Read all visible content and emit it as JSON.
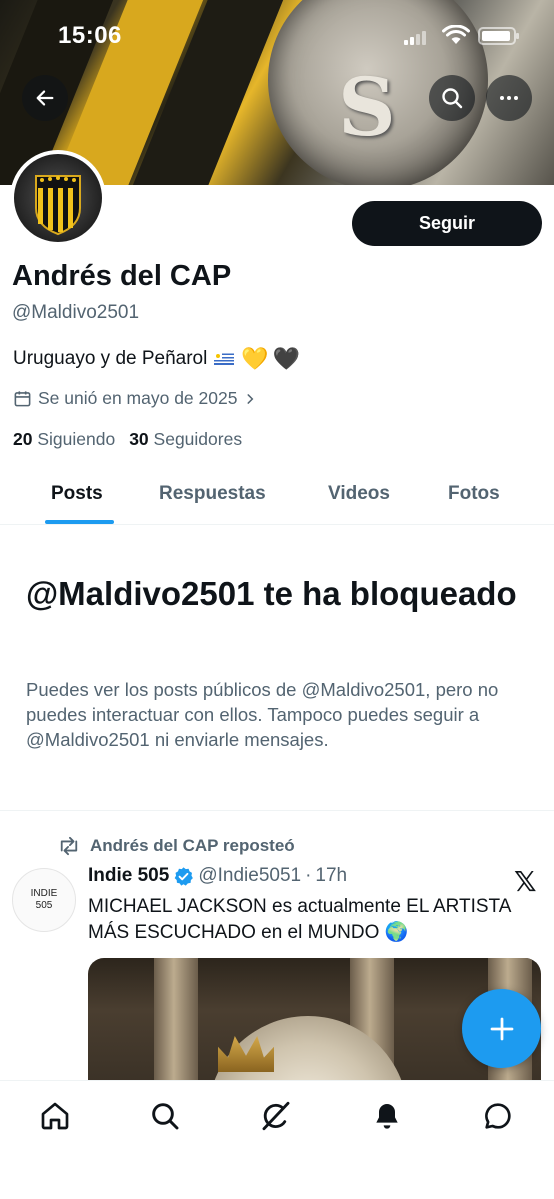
{
  "status_bar": {
    "time": "15:06"
  },
  "header": {
    "back_icon": "arrow-left-icon",
    "search_icon": "search-icon",
    "more_icon": "more-icon"
  },
  "profile": {
    "follow_label": "Seguir",
    "display_name": "Andrés del CAP",
    "handle": "@Maldivo2501",
    "bio_text": "Uruguayo y de Peñarol",
    "bio_emojis": [
      "flag-uruguay",
      "💛",
      "🖤"
    ],
    "joined": "Se unió en mayo de 2025",
    "following_count": "20",
    "following_label": "Siguiendo",
    "followers_count": "30",
    "followers_label": "Seguidores"
  },
  "tabs": [
    {
      "label": "Posts",
      "active": true
    },
    {
      "label": "Respuestas",
      "active": false
    },
    {
      "label": "Videos",
      "active": false
    },
    {
      "label": "Fotos",
      "active": false
    }
  ],
  "blocked": {
    "title": "@Maldivo2501 te ha bloqueado",
    "message": "Puedes ver los posts públicos de @Maldivo2501, pero no puedes interactuar con ellos. Tampoco puedes seguir a @Maldivo2501 ni enviarle mensajes."
  },
  "post": {
    "repost_label": "Andrés del CAP reposteó",
    "avatar_text_1": "INDIE",
    "avatar_text_2": "505",
    "author_name": "Indie 505",
    "author_handle": "@Indie5051",
    "separator": "·",
    "time": "17h",
    "text": "MICHAEL JACKSON es actualmente EL ARTISTA MÁS ESCUCHADO en el MUNDO 🌍",
    "x_logo": "𝕏"
  },
  "fab": {
    "icon": "plus-icon",
    "symbol": "+"
  },
  "bottom_nav": [
    "home-icon",
    "search-icon",
    "grok-icon",
    "notifications-icon",
    "messages-icon"
  ],
  "colors": {
    "accent": "#1d9bf0",
    "text": "#0f1419",
    "secondary": "#536471"
  }
}
